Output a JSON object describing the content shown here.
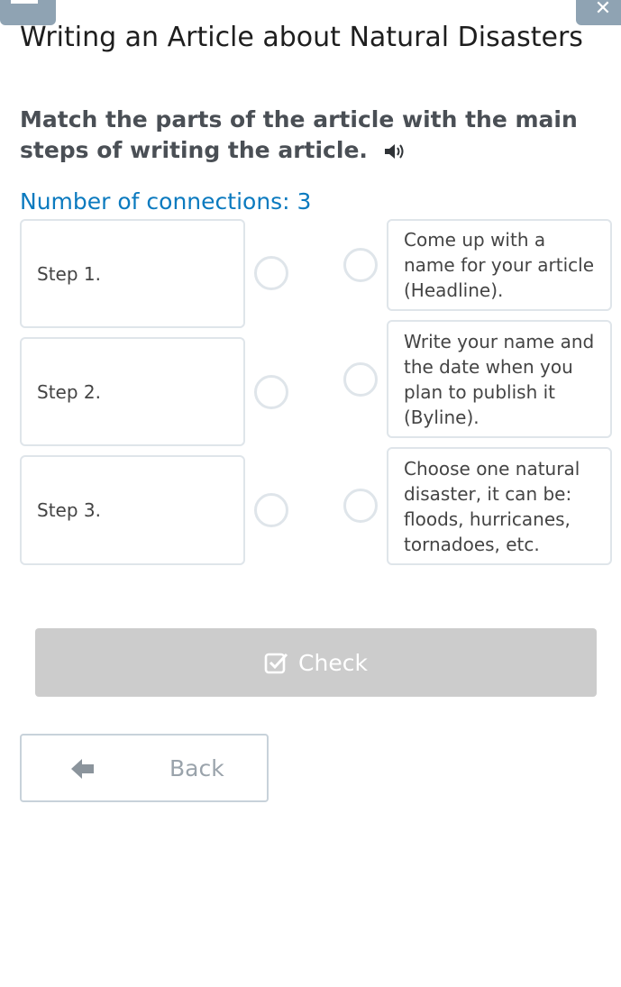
{
  "page": {
    "title": "Writing an Article about Natural Disasters",
    "task": "Match the parts of the article with the main steps of writing the article.",
    "connections": "Number of connections: 3"
  },
  "left_items": [
    {
      "label": "Step 1."
    },
    {
      "label": "Step 2."
    },
    {
      "label": "Step 3."
    }
  ],
  "right_items": [
    {
      "label": "Come up with a name for your article (Headline)."
    },
    {
      "label": "Write your name and the date when you plan to publish it (Byline)."
    },
    {
      "label": "Choose one natural disaster, it can be: floods, hurricanes, tornadoes, etc."
    }
  ],
  "buttons": {
    "check": "Check",
    "back": "Back"
  },
  "icons": {
    "speaker": "speaker-icon",
    "check": "checkbox-check-icon",
    "back": "arrow-left-icon"
  },
  "colors": {
    "accent": "#0b7abf",
    "check_button": "#cccccc",
    "border": "#dfe5ea"
  }
}
